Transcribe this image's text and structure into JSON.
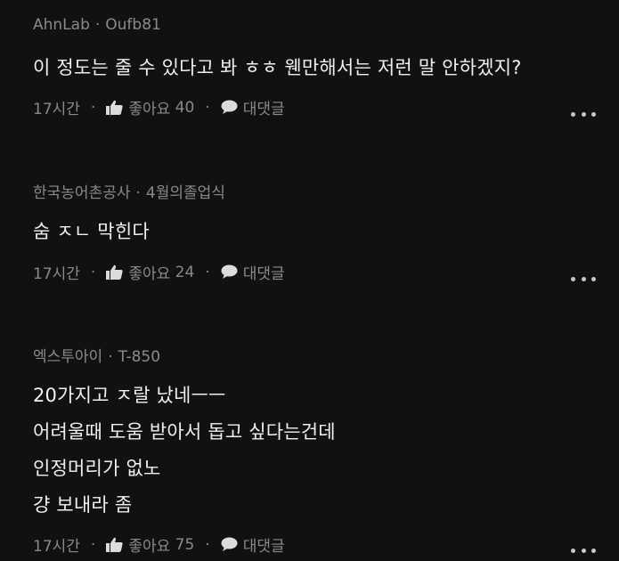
{
  "comments": [
    {
      "author": "AhnLab",
      "tag": "Oufb81",
      "lines": [
        "이 정도는 줄 수 있다고 봐 ㅎㅎ  웬만해서는 저런 말 안하겠지?"
      ],
      "time": "17시간",
      "like_label": "좋아요",
      "like_count": "40",
      "reply_label": "대댓글"
    },
    {
      "author": "한국농어촌공사",
      "tag": "4월의졸업식",
      "lines": [
        "숨 ㅈㄴ 막힌다"
      ],
      "time": "17시간",
      "like_label": "좋아요",
      "like_count": "24",
      "reply_label": "대댓글"
    },
    {
      "author": "엑스투아이",
      "tag": "T-850",
      "lines": [
        "20가지고 ㅈ랄 났네ㅡㅡ",
        "어려울때 도움 받아서 돕고 싶다는건데",
        "인정머리가 없노",
        "걍 보내라 좀"
      ],
      "time": "17시간",
      "like_label": "좋아요",
      "like_count": "75",
      "reply_label": "대댓글"
    }
  ],
  "icons": {
    "like": "thumbs-up-icon",
    "reply": "speech-bubble-icon",
    "more": "more-dots-icon"
  },
  "colors": {
    "background": "#111111",
    "text": "#f0f0f0",
    "meta": "#8a8a8a"
  }
}
